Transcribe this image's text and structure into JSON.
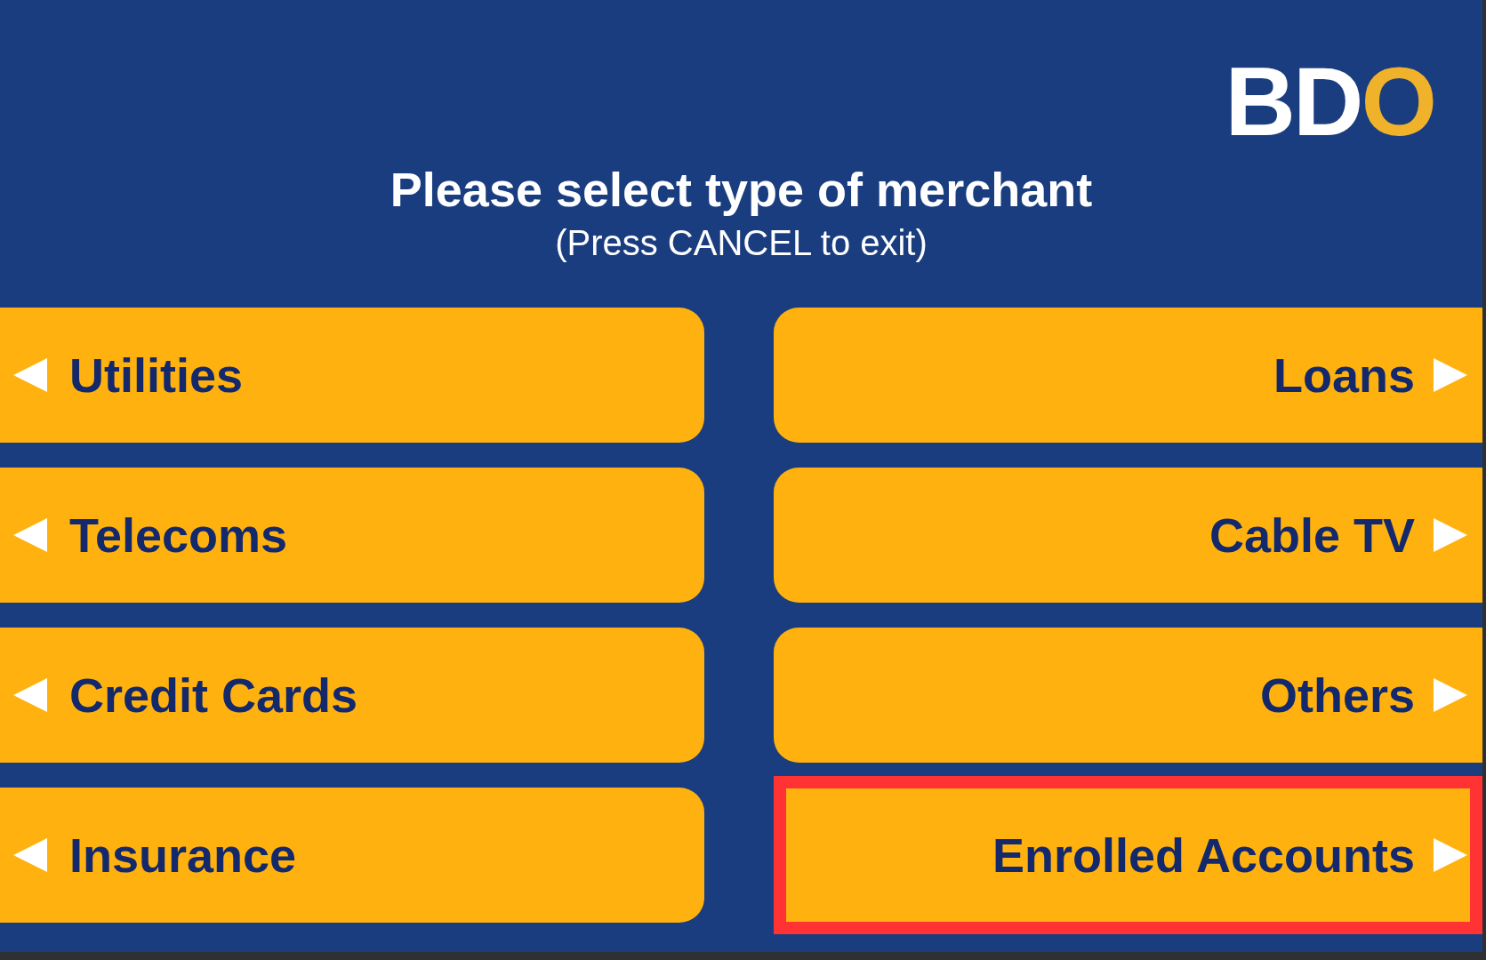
{
  "logo": {
    "segments": [
      {
        "text": "BD",
        "color": "#ffffff"
      },
      {
        "text": "O",
        "color": "#f1b22b"
      }
    ]
  },
  "title": "Please select type of merchant",
  "subtitle": "(Press CANCEL to exit)",
  "options": {
    "left": [
      {
        "label": "Utilities",
        "highlighted": false
      },
      {
        "label": "Telecoms",
        "highlighted": false
      },
      {
        "label": "Credit Cards",
        "highlighted": false
      },
      {
        "label": "Insurance",
        "highlighted": false
      }
    ],
    "right": [
      {
        "label": "Loans",
        "highlighted": false
      },
      {
        "label": "Cable TV",
        "highlighted": false
      },
      {
        "label": "Others",
        "highlighted": false
      },
      {
        "label": "Enrolled Accounts",
        "highlighted": true
      }
    ]
  }
}
